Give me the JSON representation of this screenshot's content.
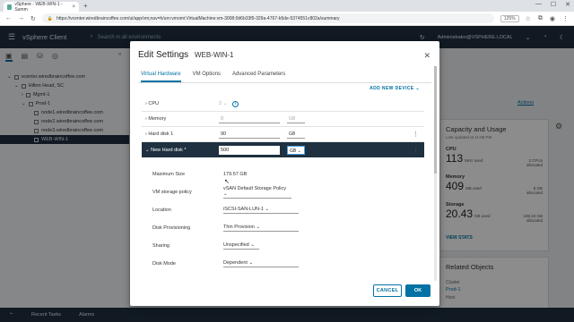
{
  "browser": {
    "tab_title": "vSphere - WEB-WIN-1 - Summ",
    "url": "https://vcenter.wiredbraincoffee.com/ui/app/vm;nav=h/urn:vmomi:VirtualMachine:vm-3008:0d6b33f9-329a-4767-b5de-5374551c802a/summary",
    "zoom": "125%"
  },
  "vsphere": {
    "title": "vSphere Client",
    "search_placeholder": "Search in all environments",
    "user": "Administrator@VSPHERE.LOCAL"
  },
  "tree": {
    "vcenter": "vcenter.wiredbraincoffee.com",
    "datacenter": "Hilton Head, SC",
    "cluster1": "Mgmt-1",
    "cluster2": "Prod-1",
    "node1": "node1.wiredbraincoffee.com",
    "node2": "node2.wiredbraincoffee.com",
    "node3": "node3.wiredbraincoffee.com",
    "vm": "WEB-WIN-1"
  },
  "background": {
    "actions": "Actions",
    "capacity_title": "Capacity and Usage",
    "capacity_updated": "Last updated at 11:08 PM",
    "cpu_label": "CPU",
    "cpu_value": "113",
    "cpu_unit": "MHz used",
    "cpu_alloc": "2 CPUs",
    "cpu_alloc_label": "allocated",
    "mem_label": "Memory",
    "mem_value": "409",
    "mem_unit": "MB used",
    "mem_alloc": "8 GB",
    "mem_alloc_label": "allocated",
    "storage_label": "Storage",
    "storage_value": "20.43",
    "storage_unit": "GB used",
    "storage_alloc": "188.23 GB",
    "storage_alloc_label": "allocated",
    "view_stats": "VIEW STATS",
    "related_title": "Related Objects",
    "cluster_label": "Cluster",
    "cluster_value": "Prod-1",
    "host_label": "Host"
  },
  "bottom": {
    "recent_tasks": "Recent Tasks",
    "alarms": "Alarms"
  },
  "dialog": {
    "title": "Edit Settings",
    "vm_name": "WEB-WIN-1",
    "tabs": [
      "Virtual Hardware",
      "VM Options",
      "Advanced Parameters"
    ],
    "add_new_device": "ADD NEW DEVICE",
    "cpu_label": "CPU",
    "cpu_value": "2",
    "memory_label": "Memory",
    "memory_value": "8",
    "memory_unit": "GB",
    "hd1_label": "Hard disk 1",
    "hd1_value": "90",
    "hd1_unit": "GB",
    "newhd_label": "New Hard disk *",
    "newhd_value": "500",
    "newhd_unit": "GB",
    "max_size_label": "Maximum Size",
    "max_size_value": "179.57 GB",
    "policy_label": "VM storage policy",
    "policy_value": "vSAN Default Storage Policy",
    "location_label": "Location",
    "location_value": "iSCSI-SAN-LUN-1",
    "provisioning_label": "Disk Provisioning",
    "provisioning_value": "Thin Provision",
    "sharing_label": "Sharing",
    "sharing_value": "Unspecified",
    "mode_label": "Disk Mode",
    "mode_value": "Dependent",
    "cancel": "CANCEL",
    "ok": "OK"
  }
}
